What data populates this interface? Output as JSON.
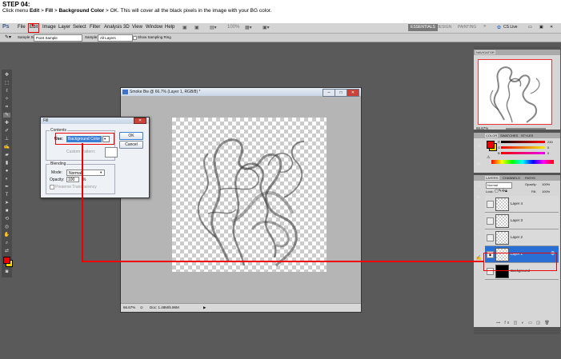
{
  "caption": {
    "step": "STEP 04:",
    "pre": "Click menu ",
    "edit": "Edit",
    "sep1": " > ",
    "fill": "Fill",
    "sep2": " > ",
    "bgcolor": "Background Color",
    "post": " > OK. This will cover all the black pixels in the image with your BG color."
  },
  "menubar": {
    "logo": "Ps",
    "items": [
      "File",
      "Edit",
      "Image",
      "Layer",
      "Select",
      "Filter",
      "Analysis",
      "3D",
      "View",
      "Window",
      "Help"
    ],
    "zoom": "100%",
    "workspaces": [
      "ESSENTIALS",
      "DESIGN",
      "PAINTING"
    ],
    "more": "»",
    "cslive": "CS Live"
  },
  "optbar": {
    "sample_size_label": "Sample Size:",
    "sample_size": "Point Sample",
    "sample_label": "Sample:",
    "sample": "All Layers",
    "ring": "Show Sampling Ring"
  },
  "document": {
    "title": "Smoke Bw @ 66.7% (Layer 1, RGB/8) *",
    "zoom": "66.67%",
    "doc": "Doc: 1.48M/5.96M"
  },
  "fill_dialog": {
    "title": "Fill",
    "contents_label": "Contents",
    "use_label": "Use:",
    "use_value": "Background Color",
    "custom_pattern": "Custom Pattern:",
    "blending_label": "Blending",
    "mode_label": "Mode:",
    "mode_value": "Normal",
    "opacity_label": "Opacity:",
    "opacity_value": "100",
    "opacity_unit": "%",
    "preserve": "Preserve Transparency",
    "ok": "OK",
    "cancel": "Cancel"
  },
  "navigator": {
    "tab": "NAVIGATOR",
    "zoom": "66.67%"
  },
  "color_panel": {
    "tabs": [
      "COLOR",
      "SWATCHES",
      "STYLES"
    ],
    "r_label": "R",
    "g_label": "G",
    "b_label": "B",
    "r": "230",
    "g": "0",
    "b": "0"
  },
  "layers_panel": {
    "tabs": [
      "LAYERS",
      "CHANNELS",
      "PATHS"
    ],
    "blend_mode": "Normal",
    "opacity_label": "Opacity:",
    "opacity": "100%",
    "lock_label": "Lock:",
    "fill_label": "Fill:",
    "fill": "100%",
    "layers": [
      "Layer 4",
      "Layer 3",
      "Layer 2",
      "Layer 1",
      "Background"
    ]
  },
  "colors": {
    "highlight_red": "#e00000",
    "selection_blue": "#2a6fd4"
  }
}
